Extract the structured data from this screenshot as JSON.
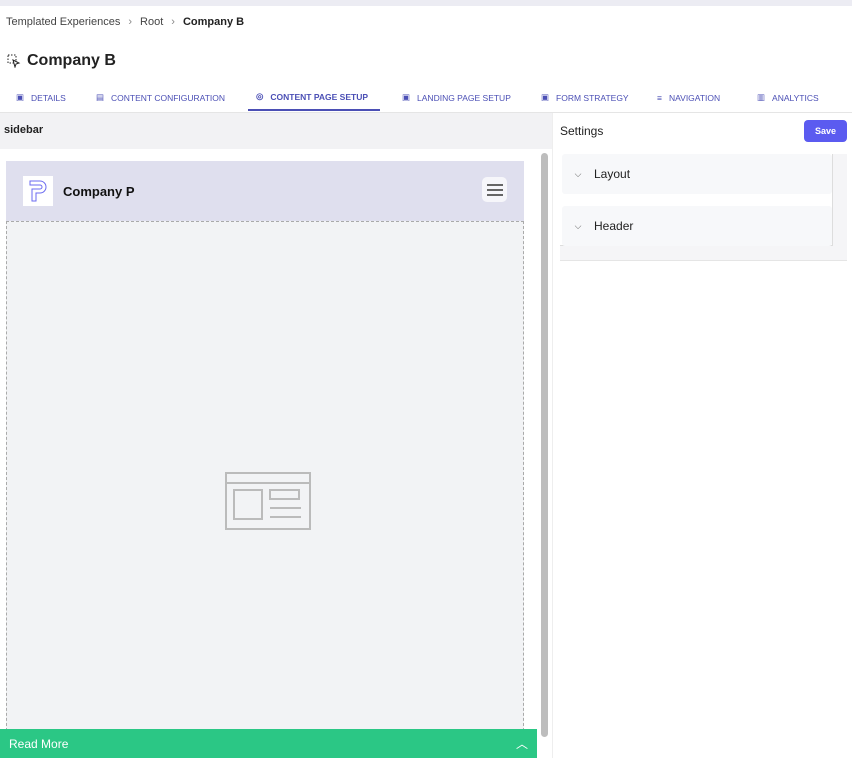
{
  "breadcrumb": [
    "Templated Experiences",
    "Root",
    "Company B"
  ],
  "page": {
    "title": "Company B",
    "icon": "select-pointer-icon"
  },
  "tabs": [
    {
      "label": "DETAILS",
      "icon": "image-icon"
    },
    {
      "label": "CONTENT CONFIGURATION",
      "icon": "document-icon"
    },
    {
      "label": "CONTENT PAGE SETUP",
      "icon": "palette-icon",
      "active": true
    },
    {
      "label": "LANDING PAGE SETUP",
      "icon": "page-icon"
    },
    {
      "label": "FORM STRATEGY",
      "icon": "form-icon"
    },
    {
      "label": "NAVIGATION",
      "icon": "menu-icon"
    },
    {
      "label": "ANALYTICS",
      "icon": "bar-chart-icon"
    }
  ],
  "preview": {
    "label": "sidebar",
    "company": "Company P",
    "read_more": "Read More",
    "accent": "#2bc785",
    "header_bg": "#dfdfee"
  },
  "settings": {
    "title": "Settings",
    "save": "Save",
    "sections": [
      "Layout",
      "Header"
    ]
  },
  "colors": {
    "primary": "#5b5bf0",
    "tab": "#4b4fb5"
  }
}
